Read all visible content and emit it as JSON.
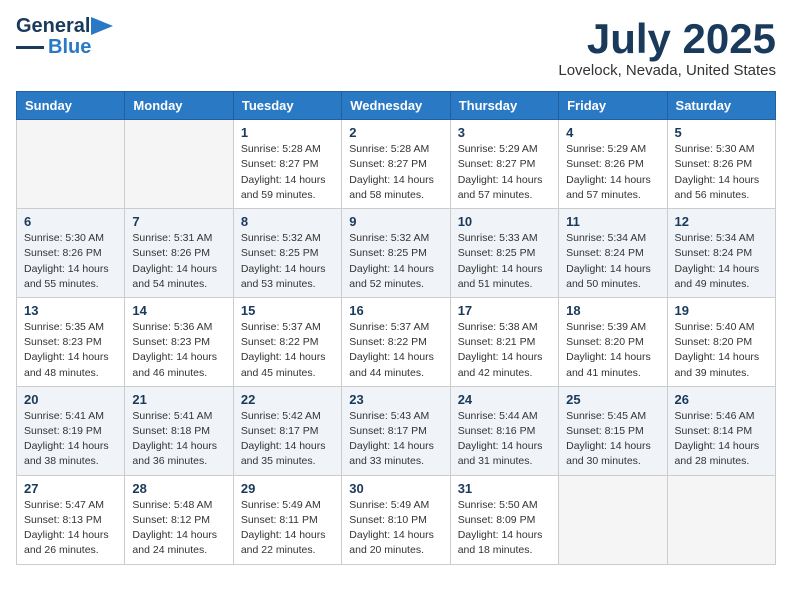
{
  "header": {
    "logo_line1": "General",
    "logo_line2": "Blue",
    "month": "July 2025",
    "location": "Lovelock, Nevada, United States"
  },
  "days_of_week": [
    "Sunday",
    "Monday",
    "Tuesday",
    "Wednesday",
    "Thursday",
    "Friday",
    "Saturday"
  ],
  "weeks": [
    [
      {
        "num": "",
        "sunrise": "",
        "sunset": "",
        "daylight": ""
      },
      {
        "num": "",
        "sunrise": "",
        "sunset": "",
        "daylight": ""
      },
      {
        "num": "1",
        "sunrise": "Sunrise: 5:28 AM",
        "sunset": "Sunset: 8:27 PM",
        "daylight": "Daylight: 14 hours and 59 minutes."
      },
      {
        "num": "2",
        "sunrise": "Sunrise: 5:28 AM",
        "sunset": "Sunset: 8:27 PM",
        "daylight": "Daylight: 14 hours and 58 minutes."
      },
      {
        "num": "3",
        "sunrise": "Sunrise: 5:29 AM",
        "sunset": "Sunset: 8:27 PM",
        "daylight": "Daylight: 14 hours and 57 minutes."
      },
      {
        "num": "4",
        "sunrise": "Sunrise: 5:29 AM",
        "sunset": "Sunset: 8:26 PM",
        "daylight": "Daylight: 14 hours and 57 minutes."
      },
      {
        "num": "5",
        "sunrise": "Sunrise: 5:30 AM",
        "sunset": "Sunset: 8:26 PM",
        "daylight": "Daylight: 14 hours and 56 minutes."
      }
    ],
    [
      {
        "num": "6",
        "sunrise": "Sunrise: 5:30 AM",
        "sunset": "Sunset: 8:26 PM",
        "daylight": "Daylight: 14 hours and 55 minutes."
      },
      {
        "num": "7",
        "sunrise": "Sunrise: 5:31 AM",
        "sunset": "Sunset: 8:26 PM",
        "daylight": "Daylight: 14 hours and 54 minutes."
      },
      {
        "num": "8",
        "sunrise": "Sunrise: 5:32 AM",
        "sunset": "Sunset: 8:25 PM",
        "daylight": "Daylight: 14 hours and 53 minutes."
      },
      {
        "num": "9",
        "sunrise": "Sunrise: 5:32 AM",
        "sunset": "Sunset: 8:25 PM",
        "daylight": "Daylight: 14 hours and 52 minutes."
      },
      {
        "num": "10",
        "sunrise": "Sunrise: 5:33 AM",
        "sunset": "Sunset: 8:25 PM",
        "daylight": "Daylight: 14 hours and 51 minutes."
      },
      {
        "num": "11",
        "sunrise": "Sunrise: 5:34 AM",
        "sunset": "Sunset: 8:24 PM",
        "daylight": "Daylight: 14 hours and 50 minutes."
      },
      {
        "num": "12",
        "sunrise": "Sunrise: 5:34 AM",
        "sunset": "Sunset: 8:24 PM",
        "daylight": "Daylight: 14 hours and 49 minutes."
      }
    ],
    [
      {
        "num": "13",
        "sunrise": "Sunrise: 5:35 AM",
        "sunset": "Sunset: 8:23 PM",
        "daylight": "Daylight: 14 hours and 48 minutes."
      },
      {
        "num": "14",
        "sunrise": "Sunrise: 5:36 AM",
        "sunset": "Sunset: 8:23 PM",
        "daylight": "Daylight: 14 hours and 46 minutes."
      },
      {
        "num": "15",
        "sunrise": "Sunrise: 5:37 AM",
        "sunset": "Sunset: 8:22 PM",
        "daylight": "Daylight: 14 hours and 45 minutes."
      },
      {
        "num": "16",
        "sunrise": "Sunrise: 5:37 AM",
        "sunset": "Sunset: 8:22 PM",
        "daylight": "Daylight: 14 hours and 44 minutes."
      },
      {
        "num": "17",
        "sunrise": "Sunrise: 5:38 AM",
        "sunset": "Sunset: 8:21 PM",
        "daylight": "Daylight: 14 hours and 42 minutes."
      },
      {
        "num": "18",
        "sunrise": "Sunrise: 5:39 AM",
        "sunset": "Sunset: 8:20 PM",
        "daylight": "Daylight: 14 hours and 41 minutes."
      },
      {
        "num": "19",
        "sunrise": "Sunrise: 5:40 AM",
        "sunset": "Sunset: 8:20 PM",
        "daylight": "Daylight: 14 hours and 39 minutes."
      }
    ],
    [
      {
        "num": "20",
        "sunrise": "Sunrise: 5:41 AM",
        "sunset": "Sunset: 8:19 PM",
        "daylight": "Daylight: 14 hours and 38 minutes."
      },
      {
        "num": "21",
        "sunrise": "Sunrise: 5:41 AM",
        "sunset": "Sunset: 8:18 PM",
        "daylight": "Daylight: 14 hours and 36 minutes."
      },
      {
        "num": "22",
        "sunrise": "Sunrise: 5:42 AM",
        "sunset": "Sunset: 8:17 PM",
        "daylight": "Daylight: 14 hours and 35 minutes."
      },
      {
        "num": "23",
        "sunrise": "Sunrise: 5:43 AM",
        "sunset": "Sunset: 8:17 PM",
        "daylight": "Daylight: 14 hours and 33 minutes."
      },
      {
        "num": "24",
        "sunrise": "Sunrise: 5:44 AM",
        "sunset": "Sunset: 8:16 PM",
        "daylight": "Daylight: 14 hours and 31 minutes."
      },
      {
        "num": "25",
        "sunrise": "Sunrise: 5:45 AM",
        "sunset": "Sunset: 8:15 PM",
        "daylight": "Daylight: 14 hours and 30 minutes."
      },
      {
        "num": "26",
        "sunrise": "Sunrise: 5:46 AM",
        "sunset": "Sunset: 8:14 PM",
        "daylight": "Daylight: 14 hours and 28 minutes."
      }
    ],
    [
      {
        "num": "27",
        "sunrise": "Sunrise: 5:47 AM",
        "sunset": "Sunset: 8:13 PM",
        "daylight": "Daylight: 14 hours and 26 minutes."
      },
      {
        "num": "28",
        "sunrise": "Sunrise: 5:48 AM",
        "sunset": "Sunset: 8:12 PM",
        "daylight": "Daylight: 14 hours and 24 minutes."
      },
      {
        "num": "29",
        "sunrise": "Sunrise: 5:49 AM",
        "sunset": "Sunset: 8:11 PM",
        "daylight": "Daylight: 14 hours and 22 minutes."
      },
      {
        "num": "30",
        "sunrise": "Sunrise: 5:49 AM",
        "sunset": "Sunset: 8:10 PM",
        "daylight": "Daylight: 14 hours and 20 minutes."
      },
      {
        "num": "31",
        "sunrise": "Sunrise: 5:50 AM",
        "sunset": "Sunset: 8:09 PM",
        "daylight": "Daylight: 14 hours and 18 minutes."
      },
      {
        "num": "",
        "sunrise": "",
        "sunset": "",
        "daylight": ""
      },
      {
        "num": "",
        "sunrise": "",
        "sunset": "",
        "daylight": ""
      }
    ]
  ]
}
